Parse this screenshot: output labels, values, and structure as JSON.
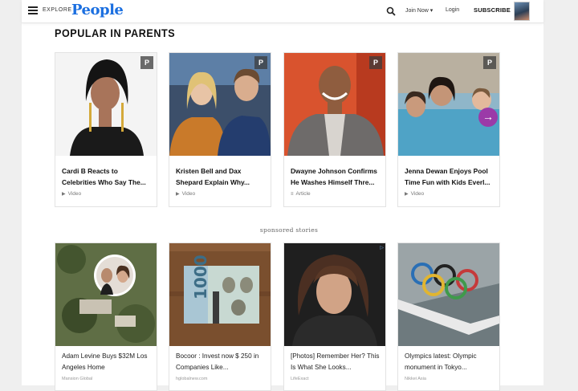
{
  "header": {
    "explore_label": "EXPLORE",
    "logo_text": "People",
    "join_label": "Join Now ▾",
    "login_label": "Login",
    "subscribe_label": "SUBSCRIBE"
  },
  "section": {
    "title": "POPULAR IN PARENTS"
  },
  "popular": [
    {
      "title": "Cardi B Reacts to Celebrities Who Say The...",
      "type_glyph": "▶",
      "type": "Video"
    },
    {
      "title": "Kristen Bell and Dax Shepard Explain Why...",
      "type_glyph": "▶",
      "type": "Video"
    },
    {
      "title": "Dwayne Johnson Confirms He Washes Himself Thre...",
      "type_glyph": "≡",
      "type": "Article"
    },
    {
      "title": "Jenna Dewan Enjoys Pool Time Fun with Kids Everl...",
      "type_glyph": "▶",
      "type": "Video"
    }
  ],
  "sponsored_label": "sponsored stories",
  "sponsored": [
    {
      "title": "Adam Levine Buys $32M Los Angeles Home",
      "source": "Mansion Global"
    },
    {
      "title": "Bocoor : Invest now $ 250 in Companies Like...",
      "source": "hglobalnew.com"
    },
    {
      "title": "[Photos] Remember Her? This Is What She Looks...",
      "source": "LifeExact"
    },
    {
      "title": "Olympics latest: Olympic monument in Tokyo...",
      "source": "Nikkei Asia"
    }
  ],
  "colors": {
    "logo": "#1b6fe0",
    "arrow": "#9b3aa8"
  }
}
